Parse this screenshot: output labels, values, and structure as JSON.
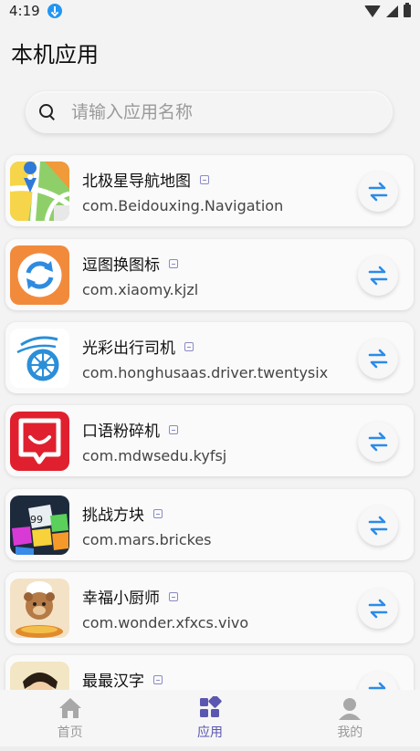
{
  "status_bar": {
    "time": "4:19"
  },
  "header": {
    "title": "本机应用"
  },
  "search": {
    "placeholder": "请输入应用名称"
  },
  "apps": [
    {
      "name": "北极星导航地图",
      "package": "com.Beidouxing.Navigation",
      "icon": "map-app-icon"
    },
    {
      "name": "逗图换图标",
      "package": "com.xiaomy.kjzl",
      "icon": "refresh-app-icon"
    },
    {
      "name": "光彩出行司机",
      "package": "com.honghusaas.driver.twentysix",
      "icon": "wheel-app-icon"
    },
    {
      "name": "口语粉碎机",
      "package": "com.mdwsedu.kyfsj",
      "icon": "smile-app-icon"
    },
    {
      "name": "挑战方块",
      "package": "com.mars.brickes",
      "icon": "blocks-app-icon"
    },
    {
      "name": "幸福小厨师",
      "package": "com.wonder.xfxcs.vivo",
      "icon": "chef-app-icon"
    },
    {
      "name": "最最汉字",
      "package": "",
      "icon": "character-app-icon"
    }
  ],
  "bottom_nav": {
    "home": "首页",
    "apps": "应用",
    "mine": "我的"
  },
  "colors": {
    "accent": "#5b57b0",
    "swap": "#2b8be8"
  }
}
